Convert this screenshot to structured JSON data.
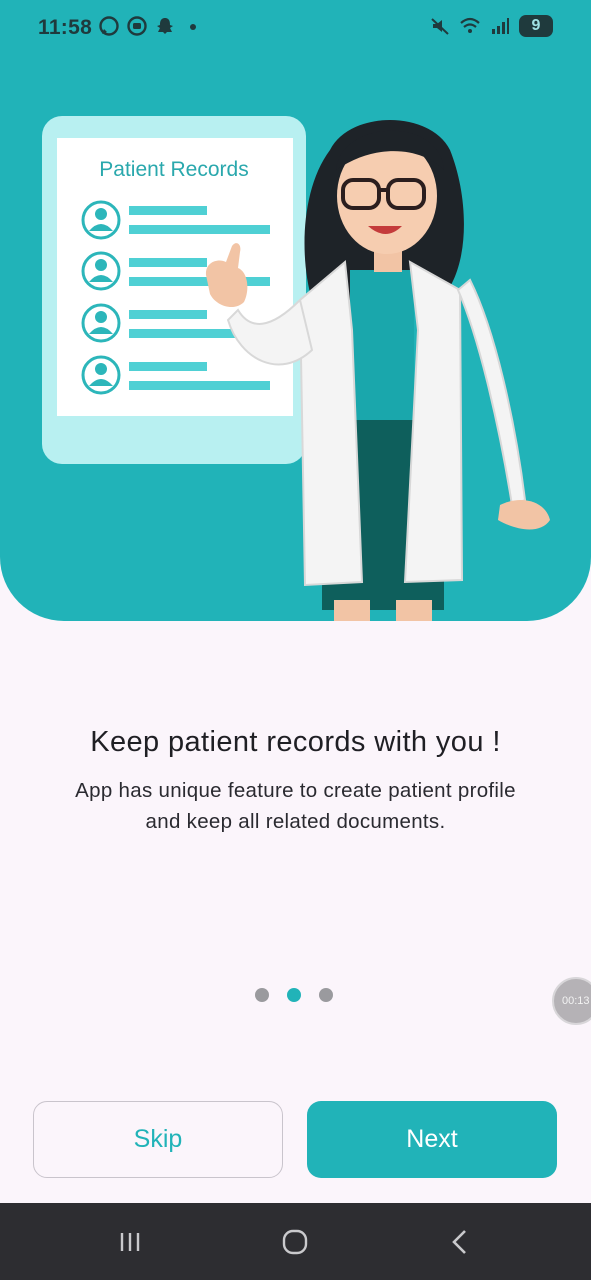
{
  "status_bar": {
    "time": "11:58",
    "battery": "9",
    "icons_left": [
      "whatsapp-icon",
      "chat-app-icon",
      "snapchat-icon",
      "dot-icon"
    ],
    "icons_right": [
      "mute-icon",
      "wifi-icon",
      "signal-icon",
      "battery-icon"
    ]
  },
  "illustration": {
    "card_title": "Patient Records",
    "rows": 4
  },
  "onboarding": {
    "title": "Keep patient records with you !",
    "subtitle_line1": "App has unique feature to create patient profile",
    "subtitle_line2": "and keep all related documents.",
    "page_count": 3,
    "active_page": 2
  },
  "timer_bubble": "00:13",
  "buttons": {
    "skip": "Skip",
    "next": "Next"
  },
  "colors": {
    "accent": "#21b3b8",
    "background": "#fbf5fb",
    "navbar": "#2d2d31"
  }
}
